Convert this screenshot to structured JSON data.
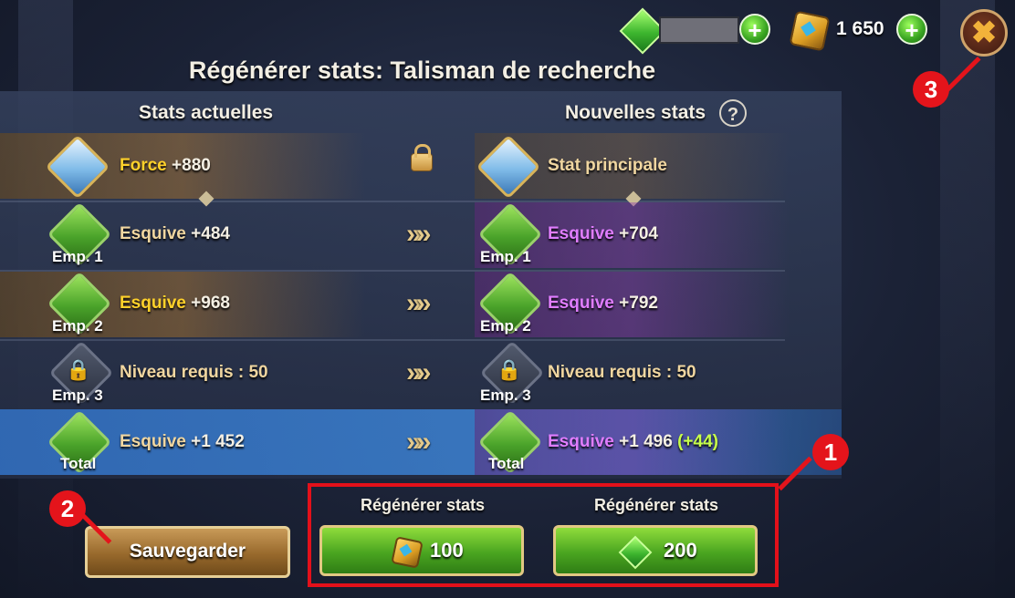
{
  "window": {
    "title": "Régénérer stats: Talisman de recherche"
  },
  "currency": {
    "cube_count": "1 650",
    "plus_label": "+",
    "close_label": "✖"
  },
  "columns": {
    "current_header": "Stats actuelles",
    "new_header": "Nouvelles stats",
    "help_label": "?"
  },
  "rows": [
    {
      "left": {
        "name": "Force",
        "value": " +880",
        "slot": ""
      },
      "right": {
        "name": "Stat principale",
        "value": "",
        "slot": ""
      }
    },
    {
      "left": {
        "name": "Esquive",
        "value": " +484",
        "slot": "Emp. 1"
      },
      "right": {
        "name": "Esquive",
        "value": " +704",
        "slot": "Emp. 1"
      }
    },
    {
      "left": {
        "name": "Esquive",
        "value": " +968",
        "slot": "Emp. 2"
      },
      "right": {
        "name": "Esquive",
        "value": " +792",
        "slot": "Emp. 2"
      }
    },
    {
      "left": {
        "name": "Niveau requis : 50",
        "value": "",
        "slot": "Emp. 3"
      },
      "right": {
        "name": "Niveau requis : 50",
        "value": "",
        "slot": "Emp. 3"
      }
    },
    {
      "left": {
        "name": "Esquive",
        "value": " +1 452",
        "slot": "Total"
      },
      "right": {
        "name": "Esquive",
        "value": " +1 496 ",
        "bonus": "(+44)",
        "slot": "Total"
      }
    }
  ],
  "arrow_glyph": "»",
  "actions": {
    "save_label": "Sauvegarder",
    "regen_label_1": "Régénérer stats",
    "regen_label_2": "Régénérer stats",
    "regen_cost_cubes": "100",
    "regen_cost_gems": "200"
  },
  "annotations": {
    "badge_1": "1",
    "badge_2": "2",
    "badge_3": "3"
  },
  "colors": {
    "annotation": "#e4141b",
    "highlight_gold": "#ffd12a",
    "highlight_purple": "#e07dff",
    "bonus_green": "#c7ff4a"
  }
}
